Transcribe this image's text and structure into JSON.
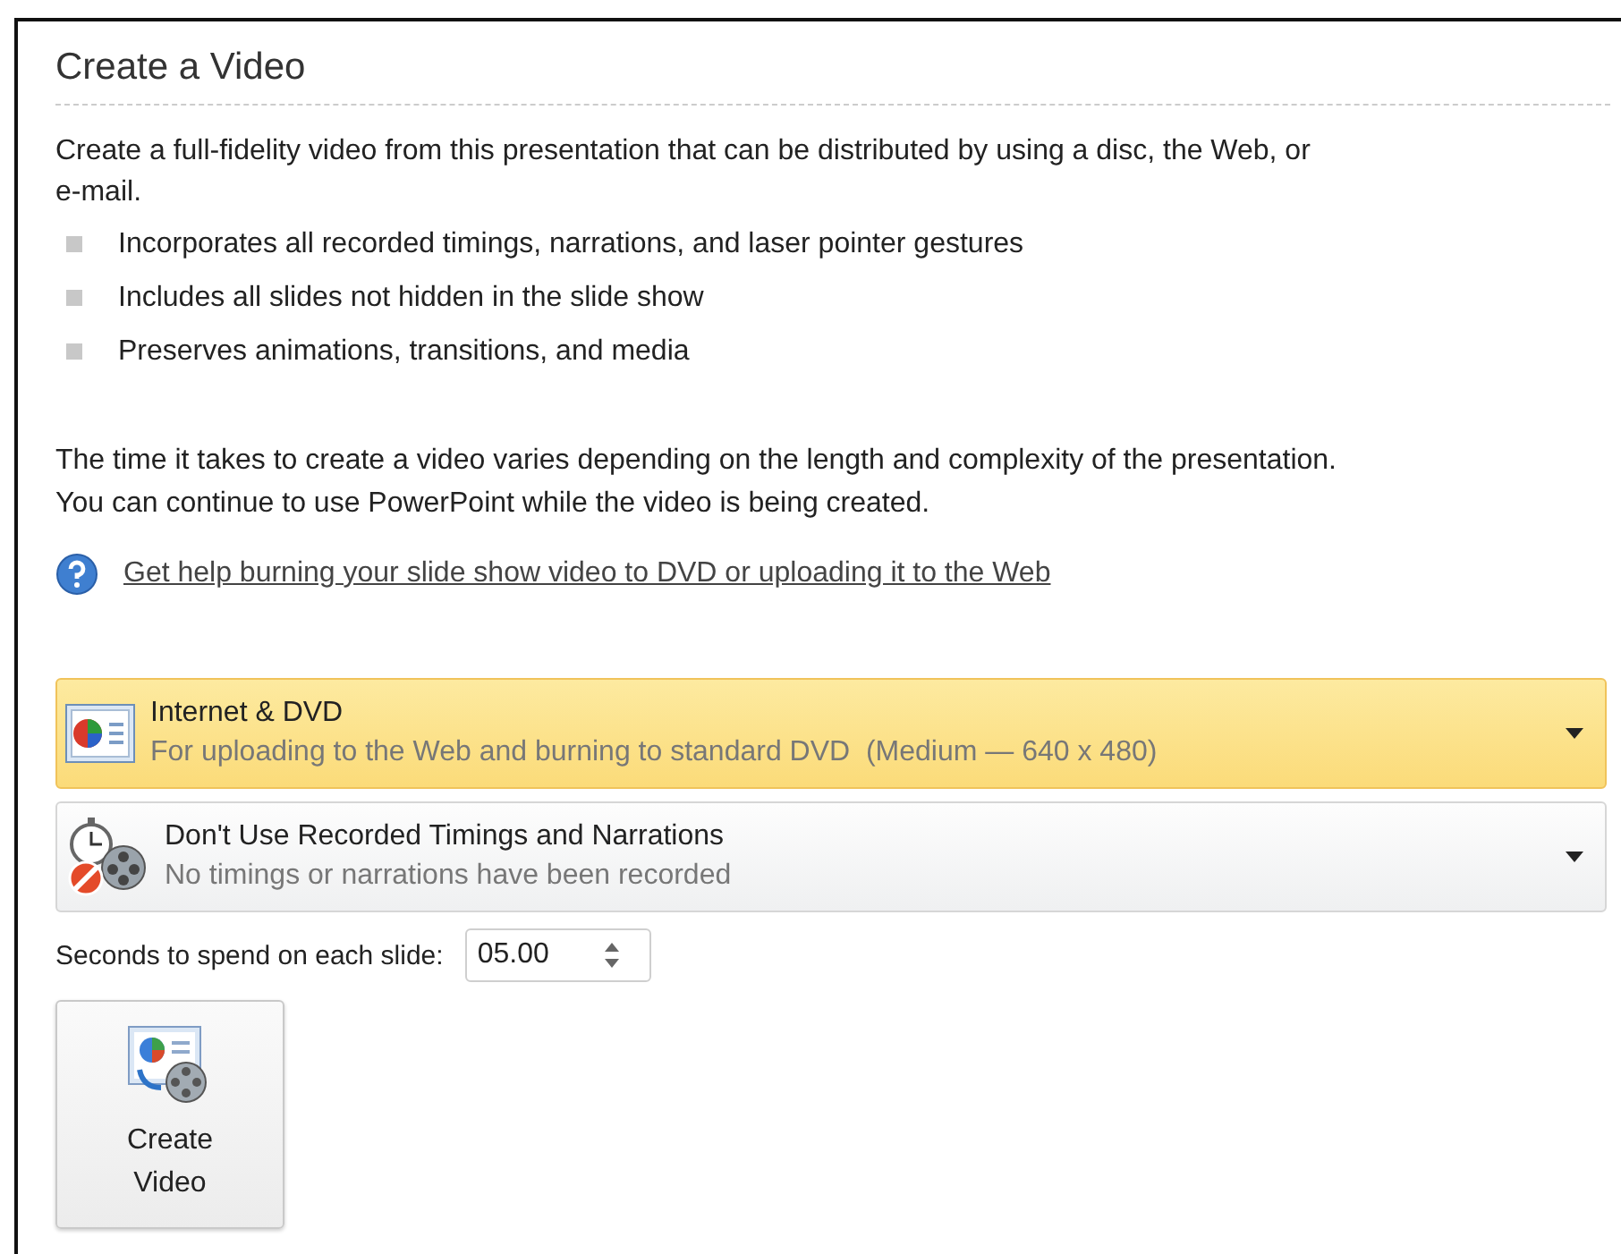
{
  "title": "Create a Video",
  "intro": "Create a full-fidelity video from this presentation that can be distributed by using a disc, the Web, or e-mail.",
  "bullets": [
    "Incorporates all recorded timings, narrations, and laser pointer gestures",
    "Includes all slides not hidden in the slide show",
    "Preserves animations, transitions, and media"
  ],
  "note": [
    "The time it takes to create a video varies depending on the length and complexity of the presentation.",
    "You can continue to use PowerPoint while the video is being created."
  ],
  "help_link": "Get help burning your slide show video to DVD or uploading it to the Web",
  "dropdowns": [
    {
      "kind": "quality",
      "title": "Internet & DVD",
      "subtitle": "For uploading to the Web and burning to standard DVD  (Medium — 640 x 480)",
      "highlighted": true
    },
    {
      "kind": "timings",
      "title": "Don't Use Recorded Timings and Narrations",
      "subtitle": "No timings or narrations have been recorded",
      "highlighted": false
    }
  ],
  "seconds": {
    "label": "Seconds to spend on each slide:",
    "value": "05.00"
  },
  "create_button": {
    "label": [
      "Create",
      "Video"
    ]
  }
}
